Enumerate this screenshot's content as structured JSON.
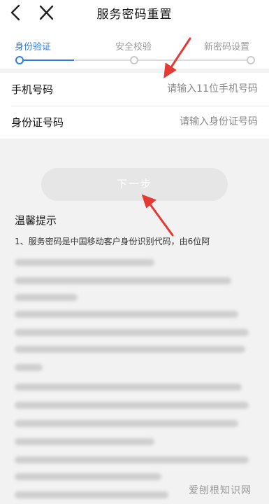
{
  "header": {
    "title": "服务密码重置"
  },
  "steps": [
    {
      "label": "身份验证",
      "active": true
    },
    {
      "label": "安全校验",
      "active": false
    },
    {
      "label": "新密码设置",
      "active": false
    }
  ],
  "form": {
    "phone": {
      "label": "手机号码",
      "placeholder": "请输入11位手机号码"
    },
    "id": {
      "label": "身份证号码",
      "placeholder": "请输入身份证号码"
    }
  },
  "next_button": {
    "label": "下一步"
  },
  "tips": {
    "title": "温馨提示",
    "line1": "1、服务密码是中国移动客户身份识别代码，由6位阿"
  },
  "watermark": "爱刨根知识网",
  "colors": {
    "accent": "#2f7be6",
    "annotation": "#e53935"
  }
}
